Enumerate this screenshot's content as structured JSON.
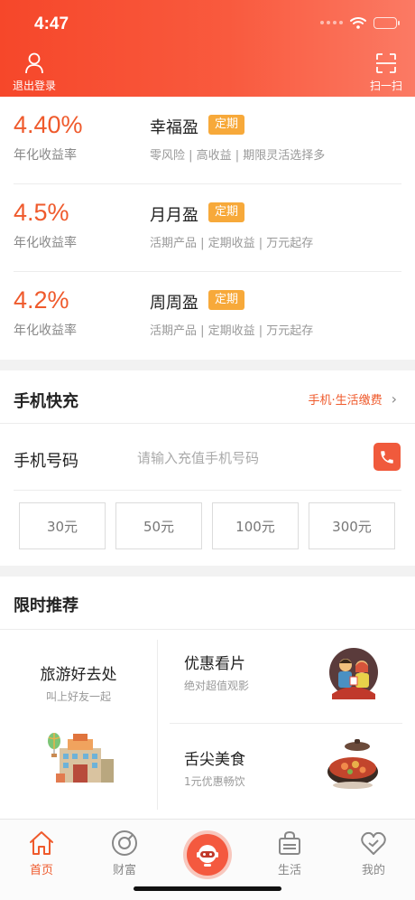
{
  "status_bar": {
    "time": "4:47"
  },
  "header": {
    "logout_label": "退出登录",
    "scan_label": "扫一扫"
  },
  "products": [
    {
      "rate": "4.40%",
      "rate_label": "年化收益率",
      "name": "幸福盈",
      "tag": "定期",
      "desc": "零风险 | 高收益 | 期限灵活选择多"
    },
    {
      "rate": "4.5%",
      "rate_label": "年化收益率",
      "name": "月月盈",
      "tag": "定期",
      "desc": "活期产品 | 定期收益 | 万元起存"
    },
    {
      "rate": "4.2%",
      "rate_label": "年化收益率",
      "name": "周周盈",
      "tag": "定期",
      "desc": "活期产品 | 定期收益 | 万元起存"
    }
  ],
  "recharge": {
    "title": "手机快充",
    "link_label": "手机·生活缴费",
    "phone_label": "手机号码",
    "phone_placeholder": "请输入充值手机号码",
    "phone_value": "",
    "amounts": [
      "30元",
      "50元",
      "100元",
      "300元"
    ]
  },
  "promo": {
    "title": "限时推荐",
    "travel": {
      "title": "旅游好去处",
      "subtitle": "叫上好友一起"
    },
    "movie": {
      "title": "优惠看片",
      "subtitle": "绝对超值观影"
    },
    "food": {
      "title": "舌尖美食",
      "subtitle": "1元优惠畅饮"
    }
  },
  "tabbar": {
    "items": [
      {
        "label": "首页",
        "icon": "home-icon",
        "active": true
      },
      {
        "label": "财富",
        "icon": "wealth-icon",
        "active": false
      },
      {
        "label": "",
        "icon": "robot-assistant-icon",
        "active": false
      },
      {
        "label": "生活",
        "icon": "shopping-bag-icon",
        "active": false
      },
      {
        "label": "我的",
        "icon": "heart-icon",
        "active": false
      }
    ]
  },
  "colors": {
    "accent": "#ef5a2c",
    "header_start": "#f6472a",
    "header_end": "#fb7a64",
    "tag": "#f7a93a"
  }
}
